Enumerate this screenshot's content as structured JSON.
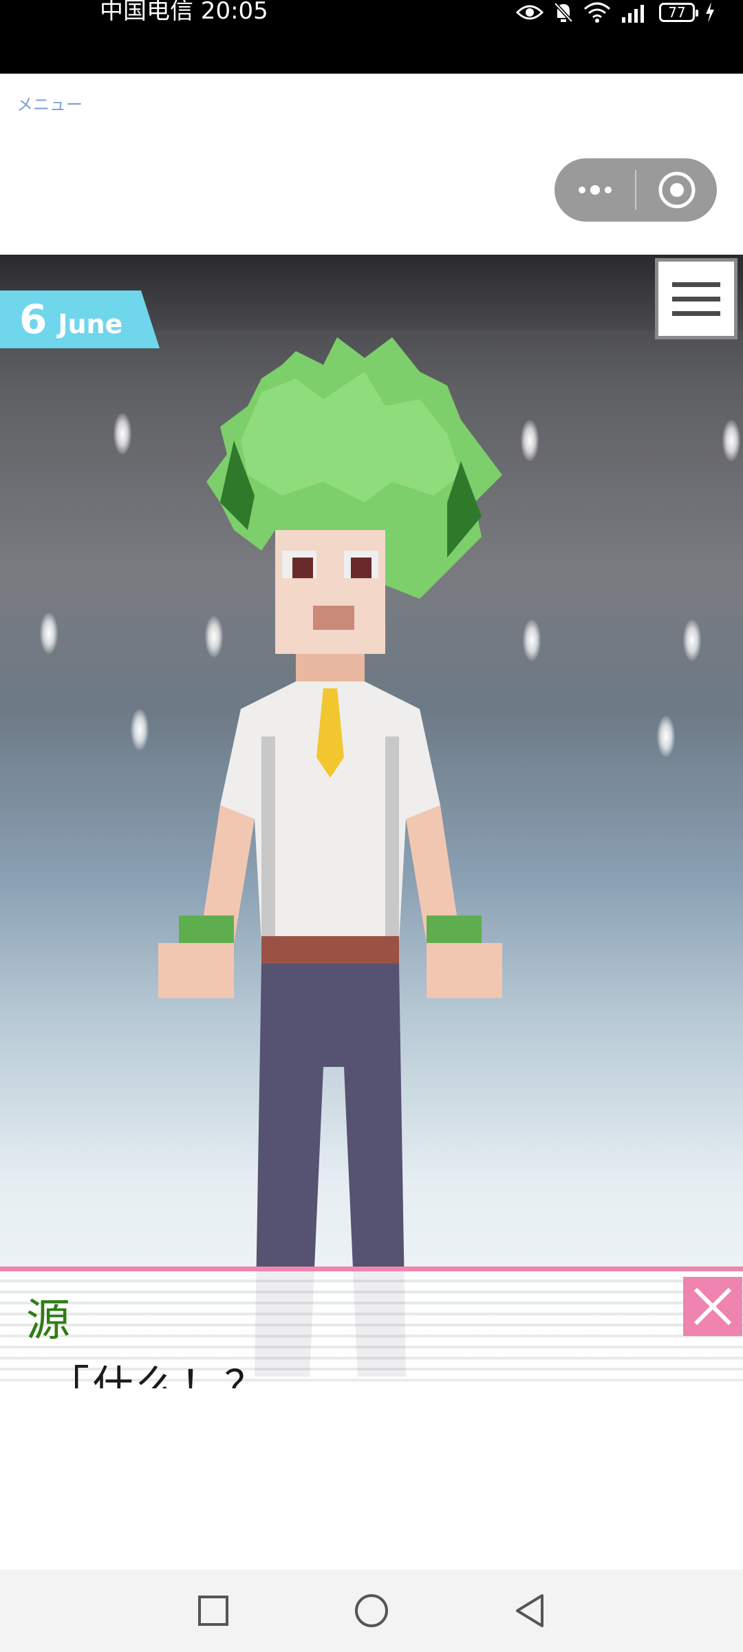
{
  "status_bar": {
    "carrier_time": "中国电信 20:05",
    "battery": "77"
  },
  "header": {
    "menu_link": "メニュー"
  },
  "game": {
    "date_day": "6",
    "date_month": "June",
    "speaker": "源",
    "line": "「什么！？",
    "colors": {
      "date_banner": "#6fd6ec",
      "dialogue_border": "#ee86ad",
      "speaker": "#2e7d12"
    }
  },
  "icons": {
    "capsule_more": "more-dots-icon",
    "capsule_close": "target-circle-icon",
    "game_menu": "hamburger-icon",
    "dialogue_close": "close-icon",
    "nav_recent": "square-icon",
    "nav_home": "circle-icon",
    "nav_back": "triangle-back-icon"
  }
}
